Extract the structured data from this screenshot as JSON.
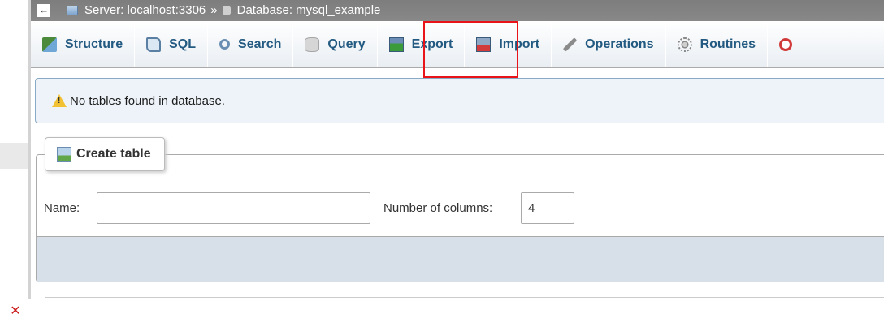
{
  "breadcrumb": {
    "back_label": "←",
    "server": "Server: localhost:3306",
    "separator": "»",
    "database": "Database: mysql_example"
  },
  "tabs": [
    {
      "label": "Structure",
      "icon": "structure-icon"
    },
    {
      "label": "SQL",
      "icon": "sql-icon"
    },
    {
      "label": "Search",
      "icon": "search-icon"
    },
    {
      "label": "Query",
      "icon": "query-icon"
    },
    {
      "label": "Export",
      "icon": "export-icon"
    },
    {
      "label": "Import",
      "icon": "import-icon"
    },
    {
      "label": "Operations",
      "icon": "operations-icon"
    },
    {
      "label": "Routines",
      "icon": "routines-icon"
    },
    {
      "label": "",
      "icon": "clock-icon"
    }
  ],
  "notice": {
    "text": "No tables found in database."
  },
  "create_table": {
    "title": "Create table",
    "name_label": "Name:",
    "name_value": "",
    "columns_label": "Number of columns:",
    "columns_value": "4"
  },
  "colors": {
    "tab_text": "#235a81",
    "highlight": "#e8141a",
    "notice_bg": "#edf3f8",
    "close": "#cc1b1b"
  }
}
